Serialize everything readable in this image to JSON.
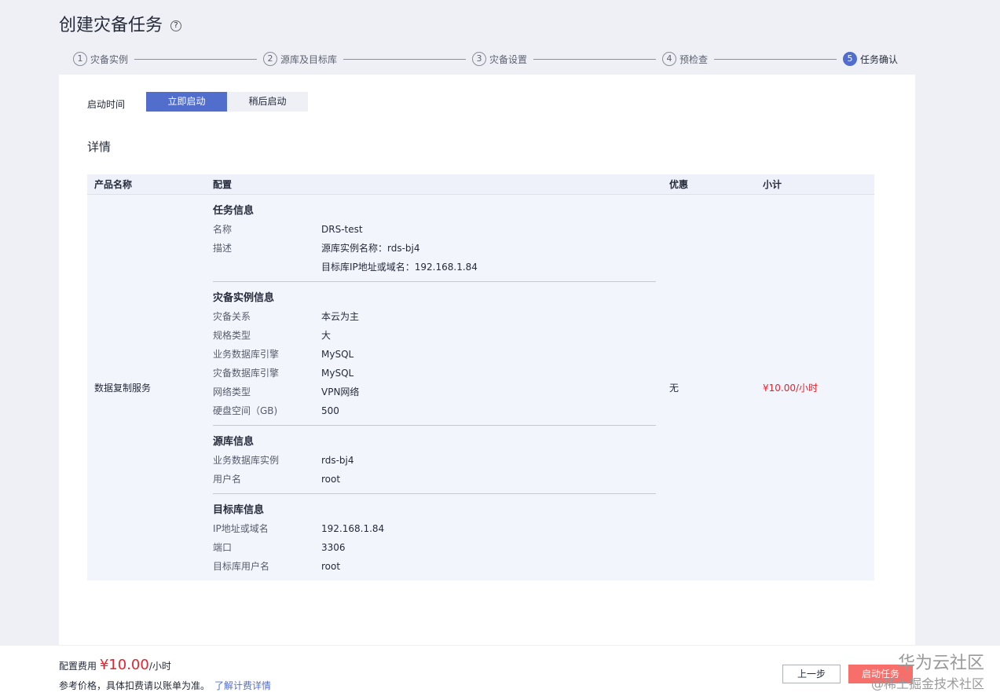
{
  "title": "创建灾备任务",
  "steps": [
    {
      "n": "1",
      "label": "灾备实例"
    },
    {
      "n": "2",
      "label": "源库及目标库"
    },
    {
      "n": "3",
      "label": "灾备设置"
    },
    {
      "n": "4",
      "label": "预检查"
    },
    {
      "n": "5",
      "label": "任务确认"
    }
  ],
  "start": {
    "label": "启动时间",
    "now": "立即启动",
    "later": "稍后启动"
  },
  "detail_title": "详情",
  "table": {
    "headers": [
      "产品名称",
      "配置",
      "优惠",
      "小计"
    ],
    "product": "数据复制服务",
    "discount": "无",
    "subtotal": "¥10.00/小时",
    "groups": [
      {
        "title": "任务信息",
        "rows": [
          [
            "名称",
            "DRS-test"
          ],
          [
            "描述",
            "源库实例名称：rds-bj4"
          ],
          [
            "",
            "目标库IP地址或域名：192.168.1.84"
          ]
        ]
      },
      {
        "title": "灾备实例信息",
        "rows": [
          [
            "灾备关系",
            "本云为主"
          ],
          [
            "规格类型",
            "大"
          ],
          [
            "业务数据库引擎",
            "MySQL"
          ],
          [
            "灾备数据库引擎",
            "MySQL"
          ],
          [
            "网络类型",
            "VPN网络"
          ],
          [
            "硬盘空间（GB)",
            "500"
          ]
        ]
      },
      {
        "title": "源库信息",
        "rows": [
          [
            "业务数据库实例",
            "rds-bj4"
          ],
          [
            "用户名",
            "root"
          ]
        ]
      },
      {
        "title": "目标库信息",
        "rows": [
          [
            "IP地址或域名",
            "192.168.1.84"
          ],
          [
            "端口",
            "3306"
          ],
          [
            "目标库用户名",
            "root"
          ]
        ]
      }
    ]
  },
  "footer": {
    "fee_label": "配置费用",
    "fee": "¥10.00",
    "unit": "/小时",
    "note": "参考价格，具体扣费请以账单为准。",
    "link": "了解计费详情",
    "prev": "上一步",
    "submit": "启动任务"
  },
  "watermark": {
    "line1": "华为云社区",
    "line2": "@稀土掘金技术社区"
  }
}
